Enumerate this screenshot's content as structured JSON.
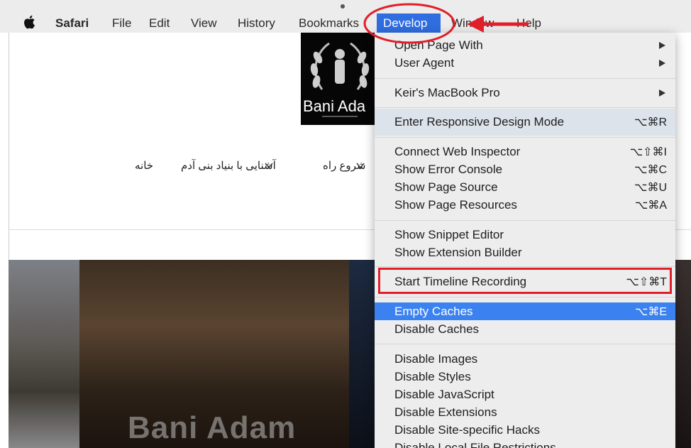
{
  "menubar": {
    "app": "Safari",
    "items": [
      "File",
      "Edit",
      "View",
      "History",
      "Bookmarks",
      "Develop",
      "Window",
      "Help"
    ]
  },
  "page": {
    "logo_text": "Bani Ada",
    "nav": [
      "خانه",
      "آشنایی با بنیاد بنی آدم",
      "شروع راه"
    ],
    "hero_watermark": "Bani Adam"
  },
  "develop_menu": {
    "open_page_with": "Open Page With",
    "user_agent": "User Agent",
    "device": "Keir's MacBook Pro",
    "responsive": {
      "label": "Enter Responsive Design Mode",
      "shortcut": "⌥⌘R"
    },
    "web_inspector": {
      "label": "Connect Web Inspector",
      "shortcut": "⌥⇧⌘I"
    },
    "error_console": {
      "label": "Show Error Console",
      "shortcut": "⌥⌘C"
    },
    "page_source": {
      "label": "Show Page Source",
      "shortcut": "⌥⌘U"
    },
    "page_resources": {
      "label": "Show Page Resources",
      "shortcut": "⌥⌘A"
    },
    "snippet_editor": "Show Snippet Editor",
    "extension_builder": "Show Extension Builder",
    "timeline": {
      "label": "Start Timeline Recording",
      "shortcut": "⌥⇧⌘T"
    },
    "empty_caches": {
      "label": "Empty Caches",
      "shortcut": "⌥⌘E"
    },
    "disable_caches": "Disable Caches",
    "disable_images": "Disable Images",
    "disable_styles": "Disable Styles",
    "disable_javascript": "Disable JavaScript",
    "disable_extensions": "Disable Extensions",
    "disable_site_hacks": "Disable Site-specific Hacks",
    "disable_local_file": "Disable Local File Restrictions"
  },
  "colors": {
    "selected": "#3b82f0",
    "annotation": "#e01f2a",
    "menu_bg": "#ededee"
  }
}
